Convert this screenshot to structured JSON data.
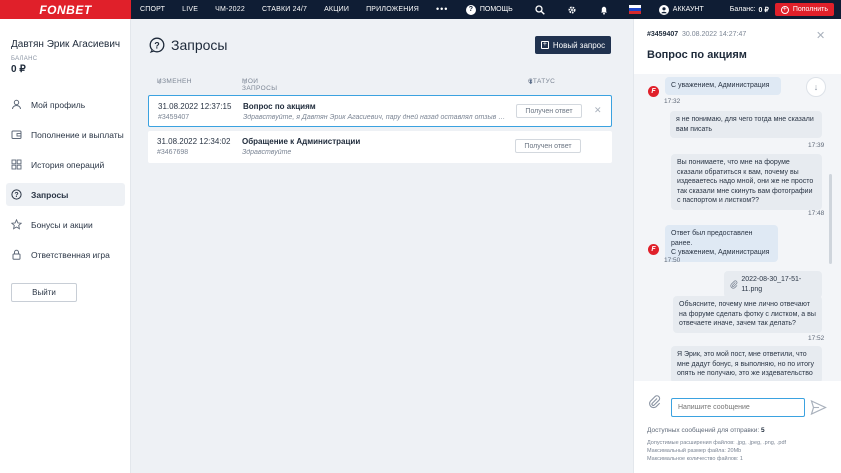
{
  "topbar": {
    "logo": "FONBET",
    "nav": [
      "СПОРТ",
      "LIVE",
      "ЧМ-2022",
      "СТАВКИ 24/7",
      "АКЦИИ",
      "ПРИЛОЖЕНИЯ"
    ],
    "more": "•••",
    "help": "ПОМОЩЬ",
    "account": "АККАУНТ",
    "balance_label": "Баланс:",
    "balance_value": "0 ₽",
    "deposit": "Пополнить"
  },
  "sidebar": {
    "user_name": "Давтян Эрик Агасиевич",
    "balance_label": "БАЛАНС",
    "balance_value": "0 ₽",
    "items": [
      {
        "label": "Мой профиль",
        "icon": "user-icon"
      },
      {
        "label": "Пополнение и выплаты",
        "icon": "wallet-icon"
      },
      {
        "label": "История операций",
        "icon": "grid-icon"
      },
      {
        "label": "Запросы",
        "icon": "question-icon"
      },
      {
        "label": "Бонусы и акции",
        "icon": "star-icon"
      },
      {
        "label": "Ответственная игра",
        "icon": "lock-icon"
      }
    ],
    "logout": "Выйти"
  },
  "main": {
    "title": "Запросы",
    "new_request": "Новый запрос",
    "columns": [
      "ИЗМЕНЕН",
      "МОИ ЗАПРОСЫ",
      "СТАТУС"
    ],
    "rows": [
      {
        "date": "31.08.2022 12:37:15",
        "id": "#3459407",
        "subject": "Вопрос по акциям",
        "preview": "Здравствуйте, я Давтян Эрик Агасиевич, пару дней назад оставлял отзыв на ле...",
        "status": "Получен ответ"
      },
      {
        "date": "31.08.2022 12:34:02",
        "id": "#3467698",
        "subject": "Обращение к Администрации",
        "preview": "Здравствуйте",
        "status": "Получен ответ"
      }
    ]
  },
  "chat": {
    "id": "#3459407",
    "date": "30.08.2022 14:27:47",
    "title": "Вопрос по акциям",
    "messages": [
      {
        "text": "С уважением, Администрация",
        "time": "17:32"
      },
      {
        "text": "я не понимаю, для чего тогда мне сказали вам писать",
        "time": "17:39"
      },
      {
        "text": "Вы понимаете, что мне на форуме сказали обратиться к вам, почему вы издеваетесь надо мной, они же не просто так сказали мне скинуть вам фотографии с паспортом и листком??",
        "time": "17:48"
      },
      {
        "text": "Ответ был предоставлен ранее.\nС уважением, Администрация",
        "time": "17:50"
      },
      {
        "text": "2022-08-30_17-51-11.png",
        "time": ""
      },
      {
        "text": "Объясните, почему мне лично отвечают на форуме сделать фотку с листком, а вы отвечаете иначе, зачем так делать?",
        "time": "17:52"
      },
      {
        "text": "Я Эрик, это мой пост, мне ответили, что мне дадут бонус, я выполняю, но по итогу опять не получаю, это же издевательство",
        "time": ""
      }
    ],
    "input_placeholder": "Напишите сообщение",
    "available_label": "Доступных сообщений для отправки:",
    "available_value": "5",
    "notes": [
      "Допустимые расширения файлов: .jpg, .jpeg, .png, .pdf",
      "Максимальный размер файла: 20Mb",
      "Максимальное количество файлов: 1"
    ]
  },
  "colors": {
    "brand_red": "#e0202a",
    "topbar_bg": "#0f1d34",
    "accent_blue": "#3ba2e0",
    "button_dark": "#20324f"
  }
}
